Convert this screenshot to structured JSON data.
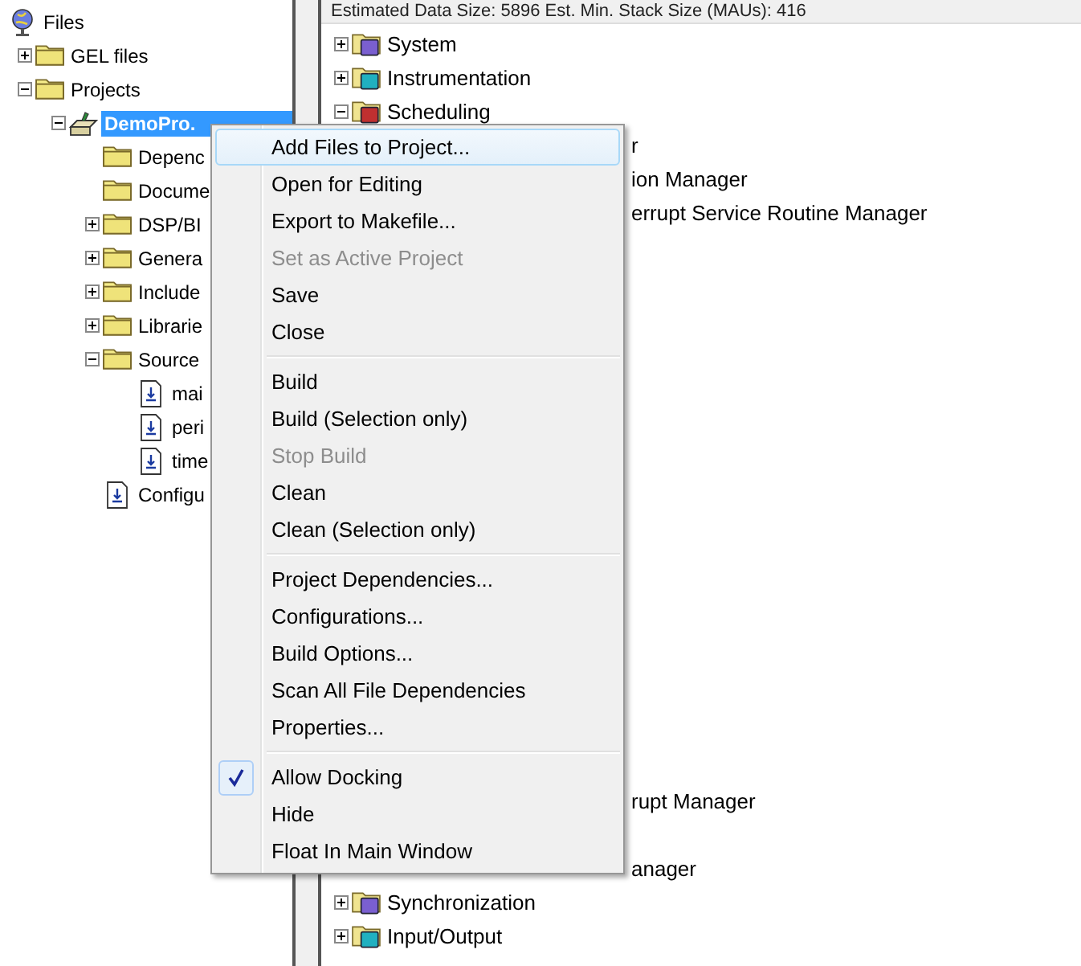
{
  "file_tree": {
    "label": "Files",
    "kind": "root",
    "children": [
      {
        "label": "GEL files",
        "kind": "folder",
        "expanded": false
      },
      {
        "label": "Projects",
        "kind": "folder",
        "expanded": true,
        "children": [
          {
            "label": "DemoPro.",
            "kind": "project",
            "expanded": true,
            "selected": true,
            "children": [
              {
                "label": "Depenc",
                "kind": "folder",
                "selected": false
              },
              {
                "label": "Docume",
                "kind": "folder",
                "selected": false
              },
              {
                "label": "DSP/BI",
                "kind": "folder",
                "expanded": false,
                "selected": false
              },
              {
                "label": "Genera",
                "kind": "folder",
                "expanded": false,
                "selected": false
              },
              {
                "label": "Include",
                "kind": "folder",
                "expanded": false,
                "selected": false
              },
              {
                "label": "Librarie",
                "kind": "folder",
                "expanded": false,
                "selected": false
              },
              {
                "label": "Source",
                "kind": "folder",
                "expanded": true,
                "selected": false,
                "children": [
                  {
                    "label": "mai",
                    "kind": "file",
                    "selected": false
                  },
                  {
                    "label": "peri",
                    "kind": "file",
                    "selected": false
                  },
                  {
                    "label": "time",
                    "kind": "file",
                    "selected": false
                  }
                ]
              },
              {
                "label": "Configu",
                "kind": "file",
                "selected": false
              }
            ]
          }
        ]
      }
    ]
  },
  "config_pane": {
    "header": "Estimated Data Size: 5896   Est. Min. Stack Size (MAUs): 416",
    "upper_items": [
      {
        "label": "System",
        "kind": "full",
        "expanded": false
      },
      {
        "label": "Instrumentation",
        "kind": "full",
        "expanded": false
      },
      {
        "label": "Scheduling",
        "kind": "full",
        "expanded": true
      },
      {
        "label": "r",
        "kind": "partial"
      },
      {
        "label": "ion Manager",
        "kind": "partial"
      },
      {
        "label": "errupt Service Routine Manager",
        "kind": "partial"
      }
    ],
    "lower_items": [
      {
        "label": "rupt Manager",
        "kind": "partial"
      },
      {
        "label": "anager",
        "kind": "partial"
      },
      {
        "label": "Synchronization",
        "kind": "full",
        "expanded": false
      },
      {
        "label": "Input/Output",
        "kind": "full",
        "expanded": false
      }
    ]
  },
  "context_menu": {
    "groups": [
      [
        {
          "label": "Add Files to Project...",
          "disabled": false,
          "highlighted": true,
          "checked": false
        },
        {
          "label": "Open for Editing",
          "disabled": false,
          "highlighted": false,
          "checked": false
        },
        {
          "label": "Export to Makefile...",
          "disabled": false,
          "highlighted": false,
          "checked": false
        },
        {
          "label": "Set as Active Project",
          "disabled": true,
          "highlighted": false,
          "checked": false
        },
        {
          "label": "Save",
          "disabled": false,
          "highlighted": false,
          "checked": false
        },
        {
          "label": "Close",
          "disabled": false,
          "highlighted": false,
          "checked": false
        }
      ],
      [
        {
          "label": "Build",
          "disabled": false,
          "highlighted": false,
          "checked": false
        },
        {
          "label": "Build (Selection only)",
          "disabled": false,
          "highlighted": false,
          "checked": false
        },
        {
          "label": "Stop Build",
          "disabled": true,
          "highlighted": false,
          "checked": false
        },
        {
          "label": "Clean",
          "disabled": false,
          "highlighted": false,
          "checked": false
        },
        {
          "label": "Clean (Selection only)",
          "disabled": false,
          "highlighted": false,
          "checked": false
        }
      ],
      [
        {
          "label": "Project Dependencies...",
          "disabled": false,
          "highlighted": false,
          "checked": false
        },
        {
          "label": "Configurations...",
          "disabled": false,
          "highlighted": false,
          "checked": false
        },
        {
          "label": "Build Options...",
          "disabled": false,
          "highlighted": false,
          "checked": false
        },
        {
          "label": "Scan All File Dependencies",
          "disabled": false,
          "highlighted": false,
          "checked": false
        },
        {
          "label": "Properties...",
          "disabled": false,
          "highlighted": false,
          "checked": false
        }
      ],
      [
        {
          "label": "Allow Docking",
          "disabled": false,
          "highlighted": false,
          "checked": true
        },
        {
          "label": "Hide",
          "disabled": false,
          "highlighted": false,
          "checked": false
        },
        {
          "label": "Float In Main Window",
          "disabled": false,
          "highlighted": false,
          "checked": false
        }
      ]
    ]
  }
}
